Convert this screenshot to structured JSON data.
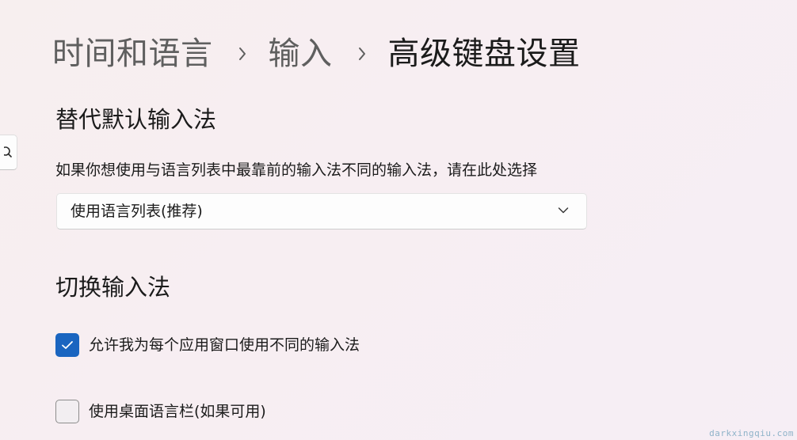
{
  "breadcrumb": {
    "items": [
      "时间和语言",
      "输入",
      "高级键盘设置"
    ]
  },
  "sections": {
    "override": {
      "title": "替代默认输入法",
      "description": "如果你想使用与语言列表中最靠前的输入法不同的输入法，请在此处选择",
      "dropdown_value": "使用语言列表(推荐)"
    },
    "switching": {
      "title": "切换输入法",
      "options": [
        {
          "label": "允许我为每个应用窗口使用不同的输入法",
          "checked": true
        },
        {
          "label": "使用桌面语言栏(如果可用)",
          "checked": false
        }
      ]
    }
  },
  "watermark": "darkxingqiu.com",
  "icons": {
    "breadcrumb_separator": "chevron-right-icon",
    "dropdown": "chevron-down-icon",
    "check": "checkmark-icon",
    "search": "search-icon"
  },
  "colors": {
    "accent": "#1a65c0",
    "text": "#1b1b1b",
    "breadcrumb_inactive": "#5f5f5f"
  }
}
